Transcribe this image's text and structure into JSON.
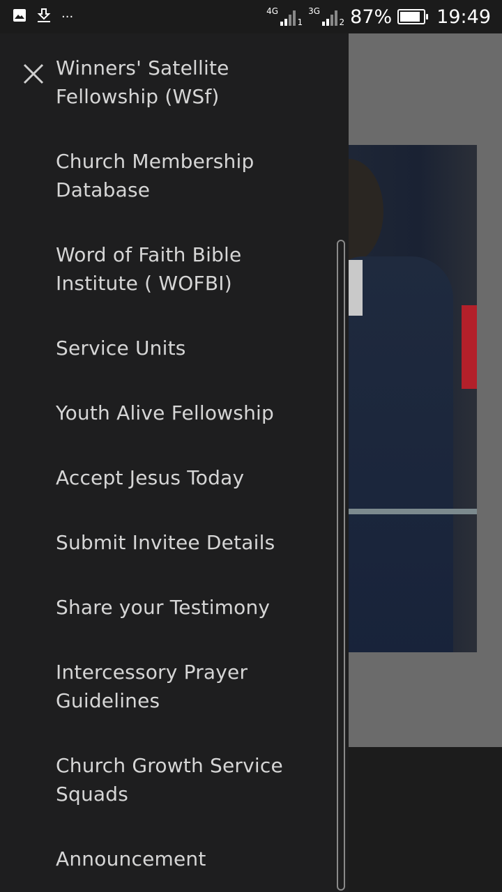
{
  "status_bar": {
    "net1_label": "4G",
    "net1_sub": "1",
    "net2_label": "3G",
    "net2_sub": "2",
    "battery_percent": "87%",
    "battery_level": 0.87,
    "time": "19:49",
    "more": "···"
  },
  "drawer": {
    "menu_items": [
      "Winners' Satellite Fellowship (WSf)",
      "Church Membership Database",
      "Word of Faith Bible Institute ( WOFBI)",
      "Service Units",
      "Youth Alive Fellowship",
      "Accept Jesus Today",
      "Submit Invitee Details",
      "Share your Testimony",
      "Intercessory Prayer Guidelines",
      "Church Growth Service Squads",
      "Announcement"
    ]
  },
  "colors": {
    "drawer_bg": "#1e1e1f",
    "menu_text": "#d6d6d6",
    "status_bar_bg": "#1b1b1b",
    "scrim": "#6b6b6b"
  },
  "icons": {
    "close": "close-icon",
    "gallery": "image-icon",
    "download": "download-icon",
    "signal": "signal-icon",
    "battery": "battery-icon"
  }
}
